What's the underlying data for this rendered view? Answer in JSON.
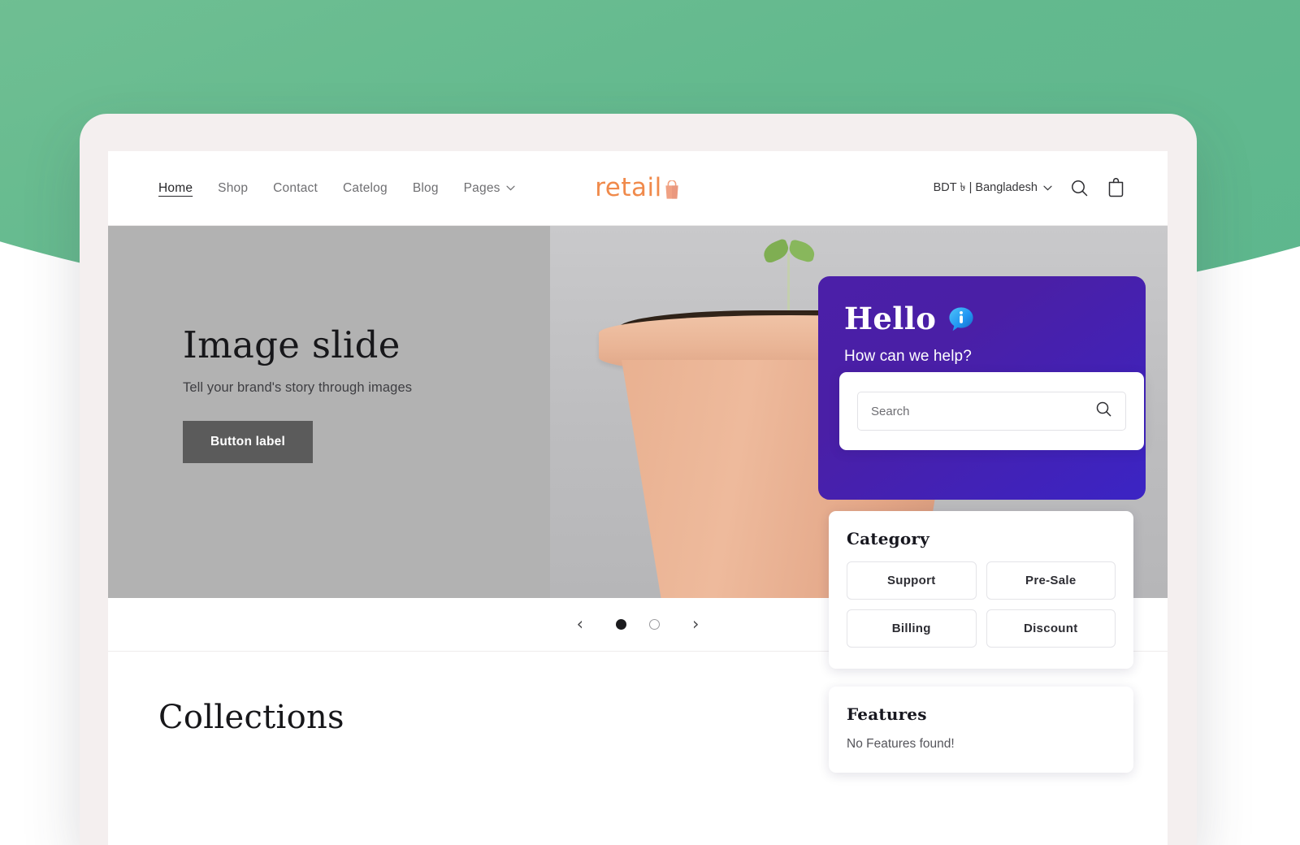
{
  "site": {
    "nav": [
      {
        "label": "Home",
        "active": true,
        "caret": false
      },
      {
        "label": "Shop",
        "active": false,
        "caret": false
      },
      {
        "label": "Contact",
        "active": false,
        "caret": false
      },
      {
        "label": "Catelog",
        "active": false,
        "caret": false
      },
      {
        "label": "Blog",
        "active": false,
        "caret": false
      },
      {
        "label": "Pages",
        "active": false,
        "caret": true
      }
    ],
    "logo_text": "retail",
    "logo_icon": "shopping-bag-icon",
    "currency_selector": "BDT ৳ | Bangladesh",
    "search_icon": "search-icon",
    "cart_icon": "cart-icon"
  },
  "hero": {
    "title": "Image slide",
    "subtitle": "Tell your brand's story through images",
    "button_label": "Button label",
    "carousel": {
      "prev_icon": "chevron-left-icon",
      "next_icon": "chevron-right-icon",
      "slides": 2,
      "active_slide": 1
    }
  },
  "collections": {
    "title": "Collections"
  },
  "chat": {
    "greeting": "Hello",
    "greeting_icon": "info-bubble-icon",
    "subtitle": "How can we help?",
    "search": {
      "placeholder": "Search",
      "value": "",
      "icon": "search-icon"
    },
    "category": {
      "title": "Category",
      "items": [
        "Support",
        "Pre-Sale",
        "Billing",
        "Discount"
      ]
    },
    "features": {
      "title": "Features",
      "empty_text": "No Features found!"
    }
  },
  "colors": {
    "brand_orange": "#f08a4b",
    "chat_purple": "#4b1fa8",
    "chat_purple_alt": "#3b24c4",
    "background_green": "#63b98e",
    "hero_gray": "#b2b2b2",
    "hero_button": "#5b5b5b",
    "info_blue": "#2196f3"
  }
}
